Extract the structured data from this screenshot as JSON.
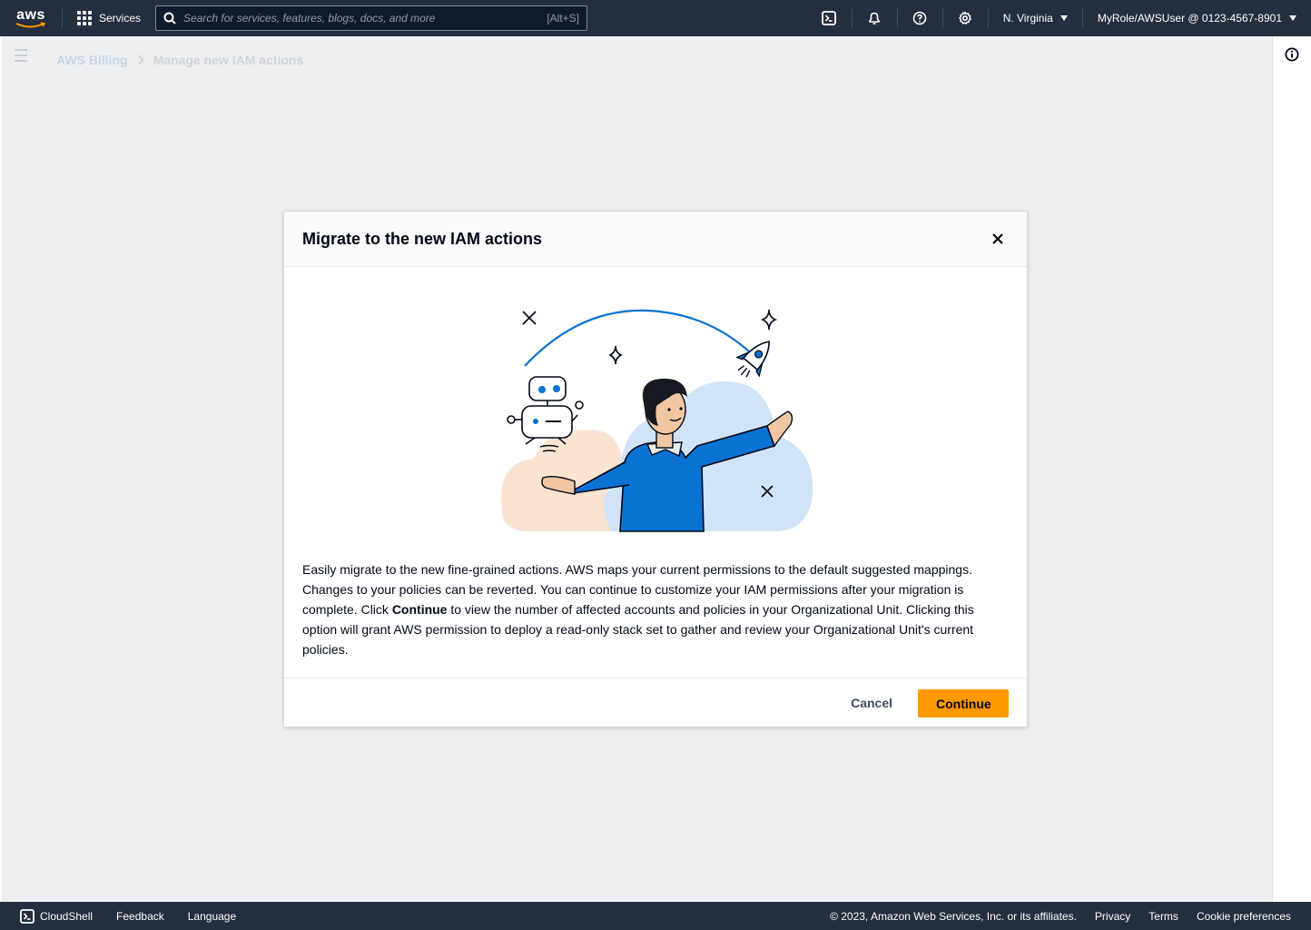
{
  "topnav": {
    "logo_text": "aws",
    "services_label": "Services",
    "search_placeholder": "Search for services, features, blogs, docs, and more",
    "search_shortcut": "[Alt+S]",
    "region_label": "N. Virginia",
    "account_label": "MyRole/AWSUser @ 0123-4567-8901"
  },
  "breadcrumb": {
    "items": [
      {
        "label": "AWS Billing"
      },
      {
        "label": "Manage new IAM actions"
      }
    ]
  },
  "modal": {
    "title": "Migrate to the new IAM actions",
    "body_part1": "Easily migrate to the new fine-grained actions. AWS maps your current permissions to the default suggested mappings. Changes to your policies can be reverted. You can continue to customize your IAM permissions after your migration is complete. Click ",
    "body_bold": "Continue",
    "body_part2": " to view the number of affected accounts and policies in your Organizational Unit. Clicking this option will grant AWS permission to deploy a read-only stack set to gather and review your Organizational Unit's current policies.",
    "cancel_label": "Cancel",
    "continue_label": "Continue"
  },
  "footer": {
    "cloudshell_label": "CloudShell",
    "feedback_label": "Feedback",
    "language_label": "Language",
    "copyright": "© 2023, Amazon Web Services, Inc. or its affiliates.",
    "privacy_label": "Privacy",
    "terms_label": "Terms",
    "cookie_label": "Cookie preferences"
  },
  "colors": {
    "nav_bg": "#232f3e",
    "primary_button": "#ff9900",
    "illustration_blue": "#0972d3"
  }
}
